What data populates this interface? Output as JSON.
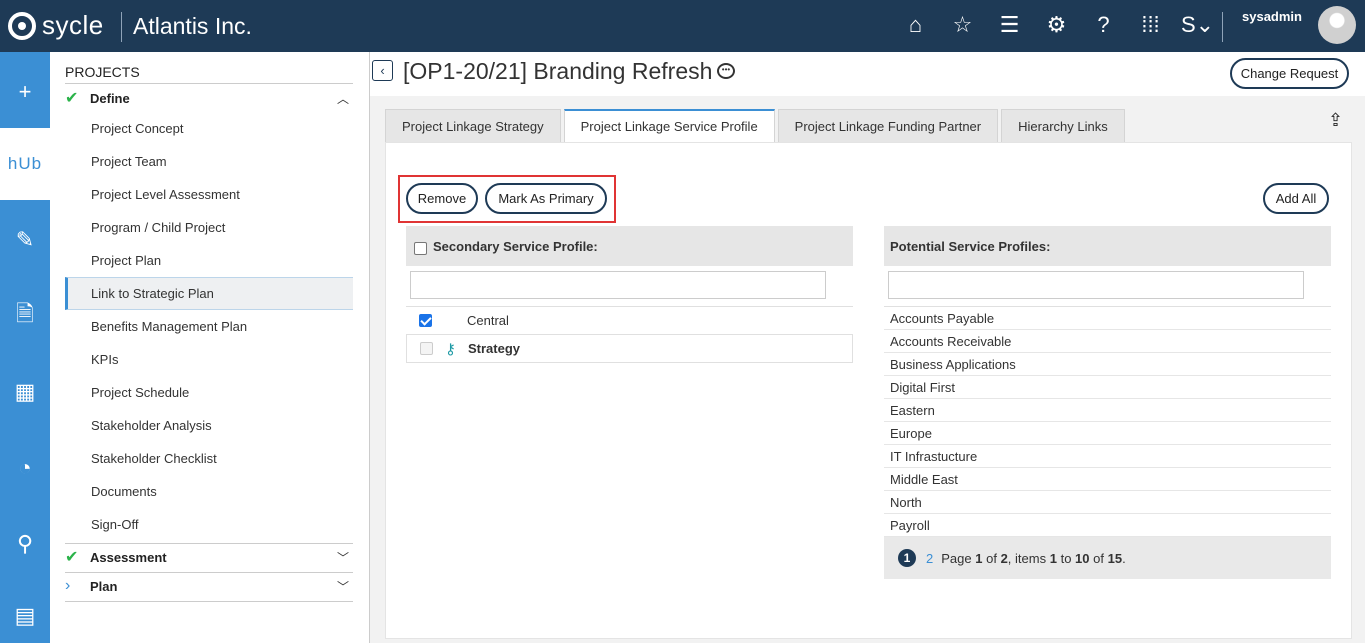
{
  "topbar": {
    "logo_text": "sycle",
    "org_name": "Atlantis Inc.",
    "username": "sysadmin",
    "icons": [
      "home-icon",
      "star-icon",
      "menu-icon",
      "settings-box-icon",
      "help-icon",
      "apps-grid-icon",
      "language-icon"
    ],
    "icon_glyphs": [
      "⌂",
      "☆",
      "☰",
      "⚙",
      "?",
      "⁞⁞⁞",
      "S⌄"
    ]
  },
  "rail": {
    "items": [
      {
        "name": "add-icon",
        "glyph": "+"
      },
      {
        "name": "hub-icon",
        "glyph": "hUb"
      },
      {
        "name": "edit-cycle-icon",
        "glyph": "✎"
      },
      {
        "name": "document-search-icon",
        "glyph": "🗎"
      },
      {
        "name": "calculator-clock-icon",
        "glyph": "▦"
      },
      {
        "name": "gauge-icon",
        "glyph": "◔"
      },
      {
        "name": "org-chart-icon",
        "glyph": "⚲"
      },
      {
        "name": "report-icon",
        "glyph": "▤"
      }
    ]
  },
  "sidebar": {
    "title": "PROJECTS",
    "sections": [
      {
        "label": "Define",
        "expanded": true
      },
      {
        "label": "Assessment",
        "expanded": false
      },
      {
        "label": "Plan",
        "expanded": false
      }
    ],
    "items": [
      "Project Concept",
      "Project Team",
      "Project Level Assessment",
      "Program / Child Project",
      "Project Plan",
      "Link to Strategic Plan",
      "Benefits Management Plan",
      "KPIs",
      "Project Schedule",
      "Stakeholder Analysis",
      "Stakeholder Checklist",
      "Documents",
      "Sign-Off"
    ],
    "active_item": "Link to Strategic Plan"
  },
  "header": {
    "title": "[OP1-20/21] Branding Refresh",
    "change_request_label": "Change Request"
  },
  "tabs": [
    {
      "label": "Project Linkage Strategy",
      "active": false
    },
    {
      "label": "Project Linkage Service Profile",
      "active": true
    },
    {
      "label": "Project Linkage Funding Partner",
      "active": false
    },
    {
      "label": "Hierarchy Links",
      "active": false
    }
  ],
  "actions": {
    "remove_label": "Remove",
    "mark_primary_label": "Mark As Primary",
    "add_all_label": "Add All"
  },
  "secondary": {
    "header": "Secondary Service Profile:",
    "filter_value": "",
    "rows": [
      {
        "label": "Central",
        "checked": true,
        "primary": false
      },
      {
        "label": "Strategy",
        "checked": false,
        "primary": true
      }
    ]
  },
  "potential": {
    "header": "Potential Service Profiles:",
    "filter_value": "",
    "rows": [
      "Accounts Payable",
      "Accounts Receivable",
      "Business Applications",
      "Digital First",
      "Eastern",
      "Europe",
      "IT Infrastucture",
      "Middle East",
      "North",
      "Payroll"
    ]
  },
  "pager": {
    "current_page": "1",
    "next_page": "2",
    "text_prefix": "Page",
    "page": "1",
    "of_label": "of",
    "total_pages": "2",
    "items_label": ", items",
    "from": "1",
    "to_label": "to",
    "to": "10",
    "of_items_label": "of",
    "total_items": "15"
  }
}
